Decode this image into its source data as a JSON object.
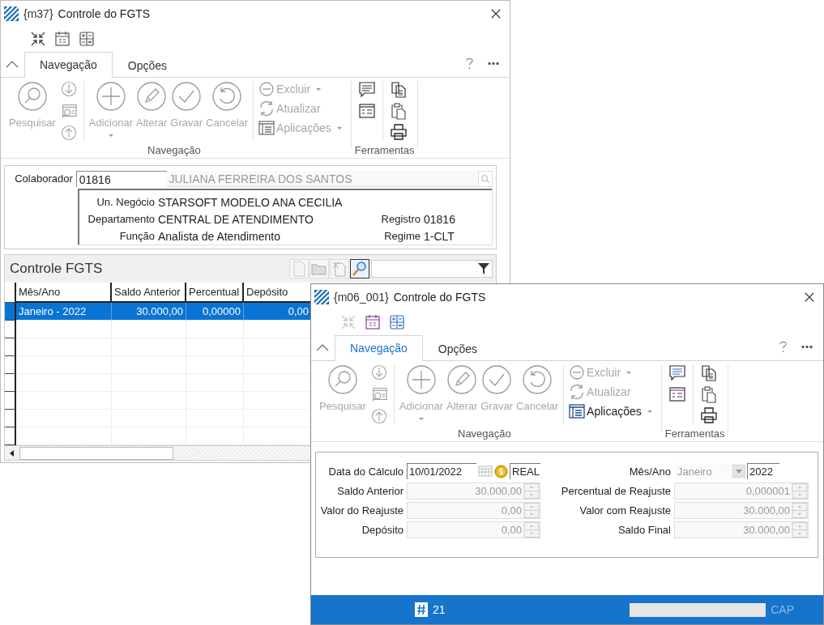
{
  "windows": [
    {
      "kind": "browse",
      "active": false,
      "code": "{m37}",
      "title": "Controle do FGTS",
      "tabs": [
        {
          "label": "Navegação",
          "selected": true
        },
        {
          "label": "Opções",
          "selected": false
        }
      ],
      "ribbon": {
        "large_buttons": [
          {
            "label": "Pesquisar",
            "disabled": true,
            "dropdown": false
          },
          {
            "label": "Adicionar",
            "disabled": true,
            "dropdown": true
          },
          {
            "label": "Alterar",
            "disabled": true,
            "dropdown": false
          },
          {
            "label": "Gravar",
            "disabled": true,
            "dropdown": false
          },
          {
            "label": "Cancelar",
            "disabled": true,
            "dropdown": false
          }
        ],
        "small_buttons": [
          {
            "label": "Excluir",
            "disabled": true,
            "dropdown": true
          },
          {
            "label": "Atualizar",
            "disabled": true,
            "dropdown": false
          },
          {
            "label": "Aplicações",
            "disabled": true,
            "dropdown": true
          }
        ],
        "groups": [
          "Navegação",
          "Ferramentas"
        ]
      },
      "collaborator": {
        "label": "Colaborador",
        "code": "01816",
        "name": "JULIANA FERREIRA DOS SANTOS",
        "info_rows": [
          {
            "fields": [
              {
                "label": "Un. Negócio",
                "value": "STARSOFT MODELO ANA CECILIA"
              }
            ]
          },
          {
            "fields": [
              {
                "label": "Departamento",
                "value": "CENTRAL DE ATENDIMENTO"
              },
              {
                "label": "Registro",
                "value": "01816"
              }
            ]
          },
          {
            "fields": [
              {
                "label": "Função",
                "value": "Analista de Atendimento"
              },
              {
                "label": "Regime",
                "value": "1-CLT"
              }
            ]
          }
        ]
      },
      "grid": {
        "title": "Controle FGTS",
        "columns": [
          "Mês/Ano",
          "Saldo Anterior",
          "Percentual",
          "Depósito"
        ],
        "rows": [
          {
            "selected": true,
            "cells": [
              "Janeiro - 2022",
              "30.000,00",
              "0,00000",
              "0,00"
            ]
          }
        ]
      }
    },
    {
      "kind": "form",
      "active": true,
      "code": "{m06_001}",
      "title": "Controle do FGTS",
      "tabs": [
        {
          "label": "Navegação",
          "selected": true
        },
        {
          "label": "Opções",
          "selected": false
        }
      ],
      "ribbon": {
        "large_buttons": [
          {
            "label": "Pesquisar",
            "disabled": true,
            "dropdown": false
          },
          {
            "label": "Adicionar",
            "disabled": true,
            "dropdown": true
          },
          {
            "label": "Alterar",
            "disabled": true,
            "dropdown": false
          },
          {
            "label": "Gravar",
            "disabled": true,
            "dropdown": false
          },
          {
            "label": "Cancelar",
            "disabled": true,
            "dropdown": false
          }
        ],
        "small_buttons": [
          {
            "label": "Excluir",
            "disabled": true,
            "dropdown": true
          },
          {
            "label": "Atualizar",
            "disabled": true,
            "dropdown": false
          },
          {
            "label": "Aplicações",
            "disabled": false,
            "dropdown": true
          }
        ],
        "groups": [
          "Navegação",
          "Ferramentas"
        ]
      },
      "form": {
        "date": {
          "label": "Data do Cálculo",
          "value": "10/01/2022",
          "currency": "REAL"
        },
        "period": {
          "label": "Mês/Ano",
          "month": "Janeiro",
          "month_disabled": true,
          "year": "2022"
        },
        "left_fields": [
          {
            "label": "Saldo Anterior",
            "value": "30.000,00",
            "disabled": true
          },
          {
            "label": "Valor do Reajuste",
            "value": "0,00",
            "disabled": true
          },
          {
            "label": "Depósito",
            "value": "0,00",
            "disabled": true
          }
        ],
        "right_fields": [
          {
            "label": "Percentual de Reajuste",
            "value": "0,000001",
            "disabled": true
          },
          {
            "label": "Valor com Reajuste",
            "value": "30.000,00",
            "disabled": true
          },
          {
            "label": "Saldo Final",
            "value": "30.000,00",
            "disabled": true
          }
        ]
      },
      "status_bar": {
        "record": "21",
        "caps": {
          "label": "CAP",
          "on": false
        }
      }
    }
  ]
}
